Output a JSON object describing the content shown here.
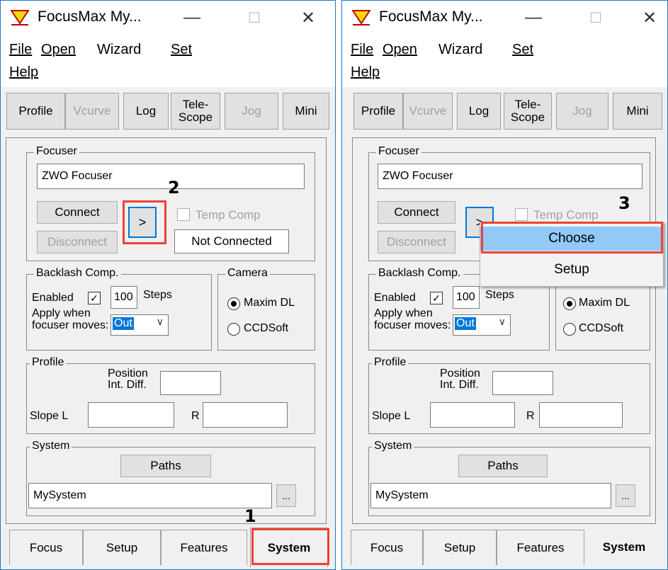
{
  "window": {
    "title": "FocusMax   My...",
    "minimize": "—",
    "maximize": "☐",
    "close": "✕"
  },
  "menu": {
    "file": "File",
    "open": "Open",
    "wizard": "Wizard",
    "set": "Set",
    "help": "Help"
  },
  "toolbar": {
    "profile": "Profile",
    "vcurve": "Vcurve",
    "log": "Log",
    "telescope_line1": "Tele-",
    "telescope_line2": "Scope",
    "jog": "Jog",
    "mini": "Mini"
  },
  "focuser": {
    "group": "Focuser",
    "name": "ZWO Focuser",
    "connect": "Connect",
    "disconnect": "Disconnect",
    "chooser": ">",
    "temp_comp": "Temp Comp",
    "status": "Not Connected"
  },
  "backlash": {
    "group": "Backlash Comp.",
    "enabled_label": "Enabled",
    "enabled_check": "✓",
    "steps_value": "100",
    "steps_label": "Steps",
    "apply_line1": "Apply when",
    "apply_line2": "focuser moves:",
    "direction": "Out",
    "arrow": "∨"
  },
  "camera": {
    "group": "Camera",
    "option1": "Maxim DL",
    "option2": "CCDSoft"
  },
  "profile": {
    "group": "Profile",
    "position_line1": "Position",
    "position_line2": "Int. Diff.",
    "slope_label": "Slope  L",
    "r_label": "R"
  },
  "system": {
    "group": "System",
    "paths": "Paths",
    "name": "MySystem",
    "browse": "..."
  },
  "tabs": {
    "focus": "Focus",
    "setup": "Setup",
    "features": "Features",
    "system": "System"
  },
  "context_menu": {
    "choose": "Choose",
    "setup": "Setup"
  },
  "annotations": {
    "step1": "1",
    "step2": "2",
    "step3": "3"
  }
}
